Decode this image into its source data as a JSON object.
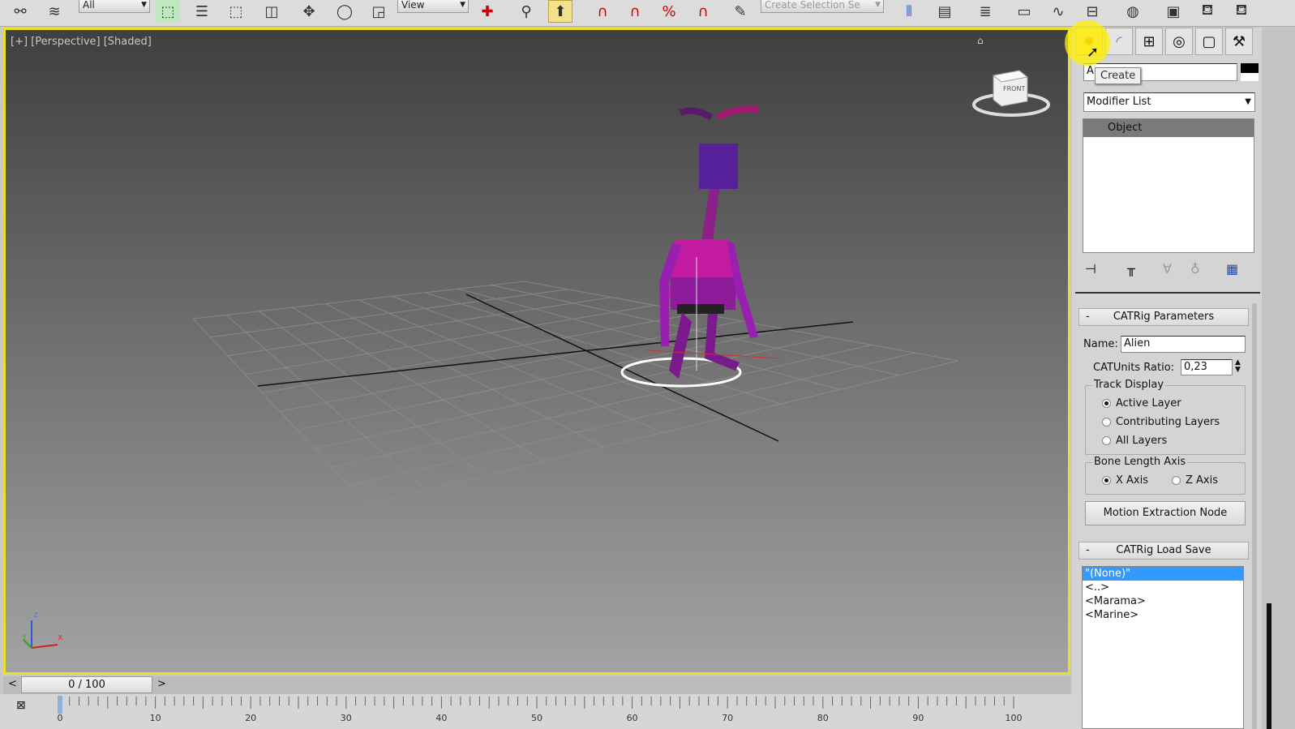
{
  "toolbar": {
    "selection_filter": "All",
    "ref_coord": "View",
    "named_selection": "Create Selection Se",
    "icons": [
      "link-icon",
      "bind-space-warp-icon",
      "select-object-icon",
      "select-by-name-icon",
      "rect-region-icon",
      "window-crossing-icon",
      "move-icon",
      "rotate-icon",
      "scale-icon",
      "pivot-icon",
      "manipulate-icon",
      "keyboard-shortcut-icon",
      "snap-icon",
      "angle-snap-icon",
      "percent-snap-icon",
      "spinner-snap-icon",
      "edit-named-sel-icon",
      "mirror-icon",
      "align-icon",
      "layer-manager-icon",
      "graphite-icon",
      "curve-editor-icon",
      "schematic-icon",
      "material-editor-icon",
      "render-setup-icon",
      "rendered-frame-icon",
      "render-icon"
    ]
  },
  "viewport": {
    "label": "[+] [Perspective] [Shaded]",
    "viewcube_face": "FRONT",
    "axis_labels": {
      "z": "z",
      "y": "y",
      "x": "x"
    },
    "accent_color": "#e9e02a"
  },
  "command_panel": {
    "tabs": [
      "create",
      "modify",
      "hierarchy",
      "motion",
      "display",
      "utilities"
    ],
    "tooltip": "Create",
    "object_name": "A",
    "modifier_list": "Modifier List",
    "stack_items": [
      "Object"
    ],
    "catrig_parameters": {
      "title": "CATRig Parameters",
      "name_label": "Name:",
      "name_value": "Alien",
      "units_label": "CATUnits Ratio:",
      "units_value": "0,23",
      "track_display_label": "Track Display",
      "track_options": [
        "Active Layer",
        "Contributing Layers",
        "All Layers"
      ],
      "track_selected": 0,
      "bone_axis_label": "Bone Length Axis",
      "bone_options": [
        "X Axis",
        "Z Axis"
      ],
      "bone_selected": 0,
      "motion_button": "Motion Extraction Node"
    },
    "catrig_load_save": {
      "title": "CATRig Load Save",
      "items": [
        "\"(None)\"",
        "<..>",
        "<Marama>",
        "<Marine>"
      ],
      "selected": 0
    }
  },
  "timeline": {
    "frame": "0 / 100",
    "prev": "<",
    "next": ">",
    "ticks": [
      "0",
      "10",
      "20",
      "30",
      "40",
      "50",
      "60",
      "70",
      "80",
      "90",
      "100"
    ]
  }
}
